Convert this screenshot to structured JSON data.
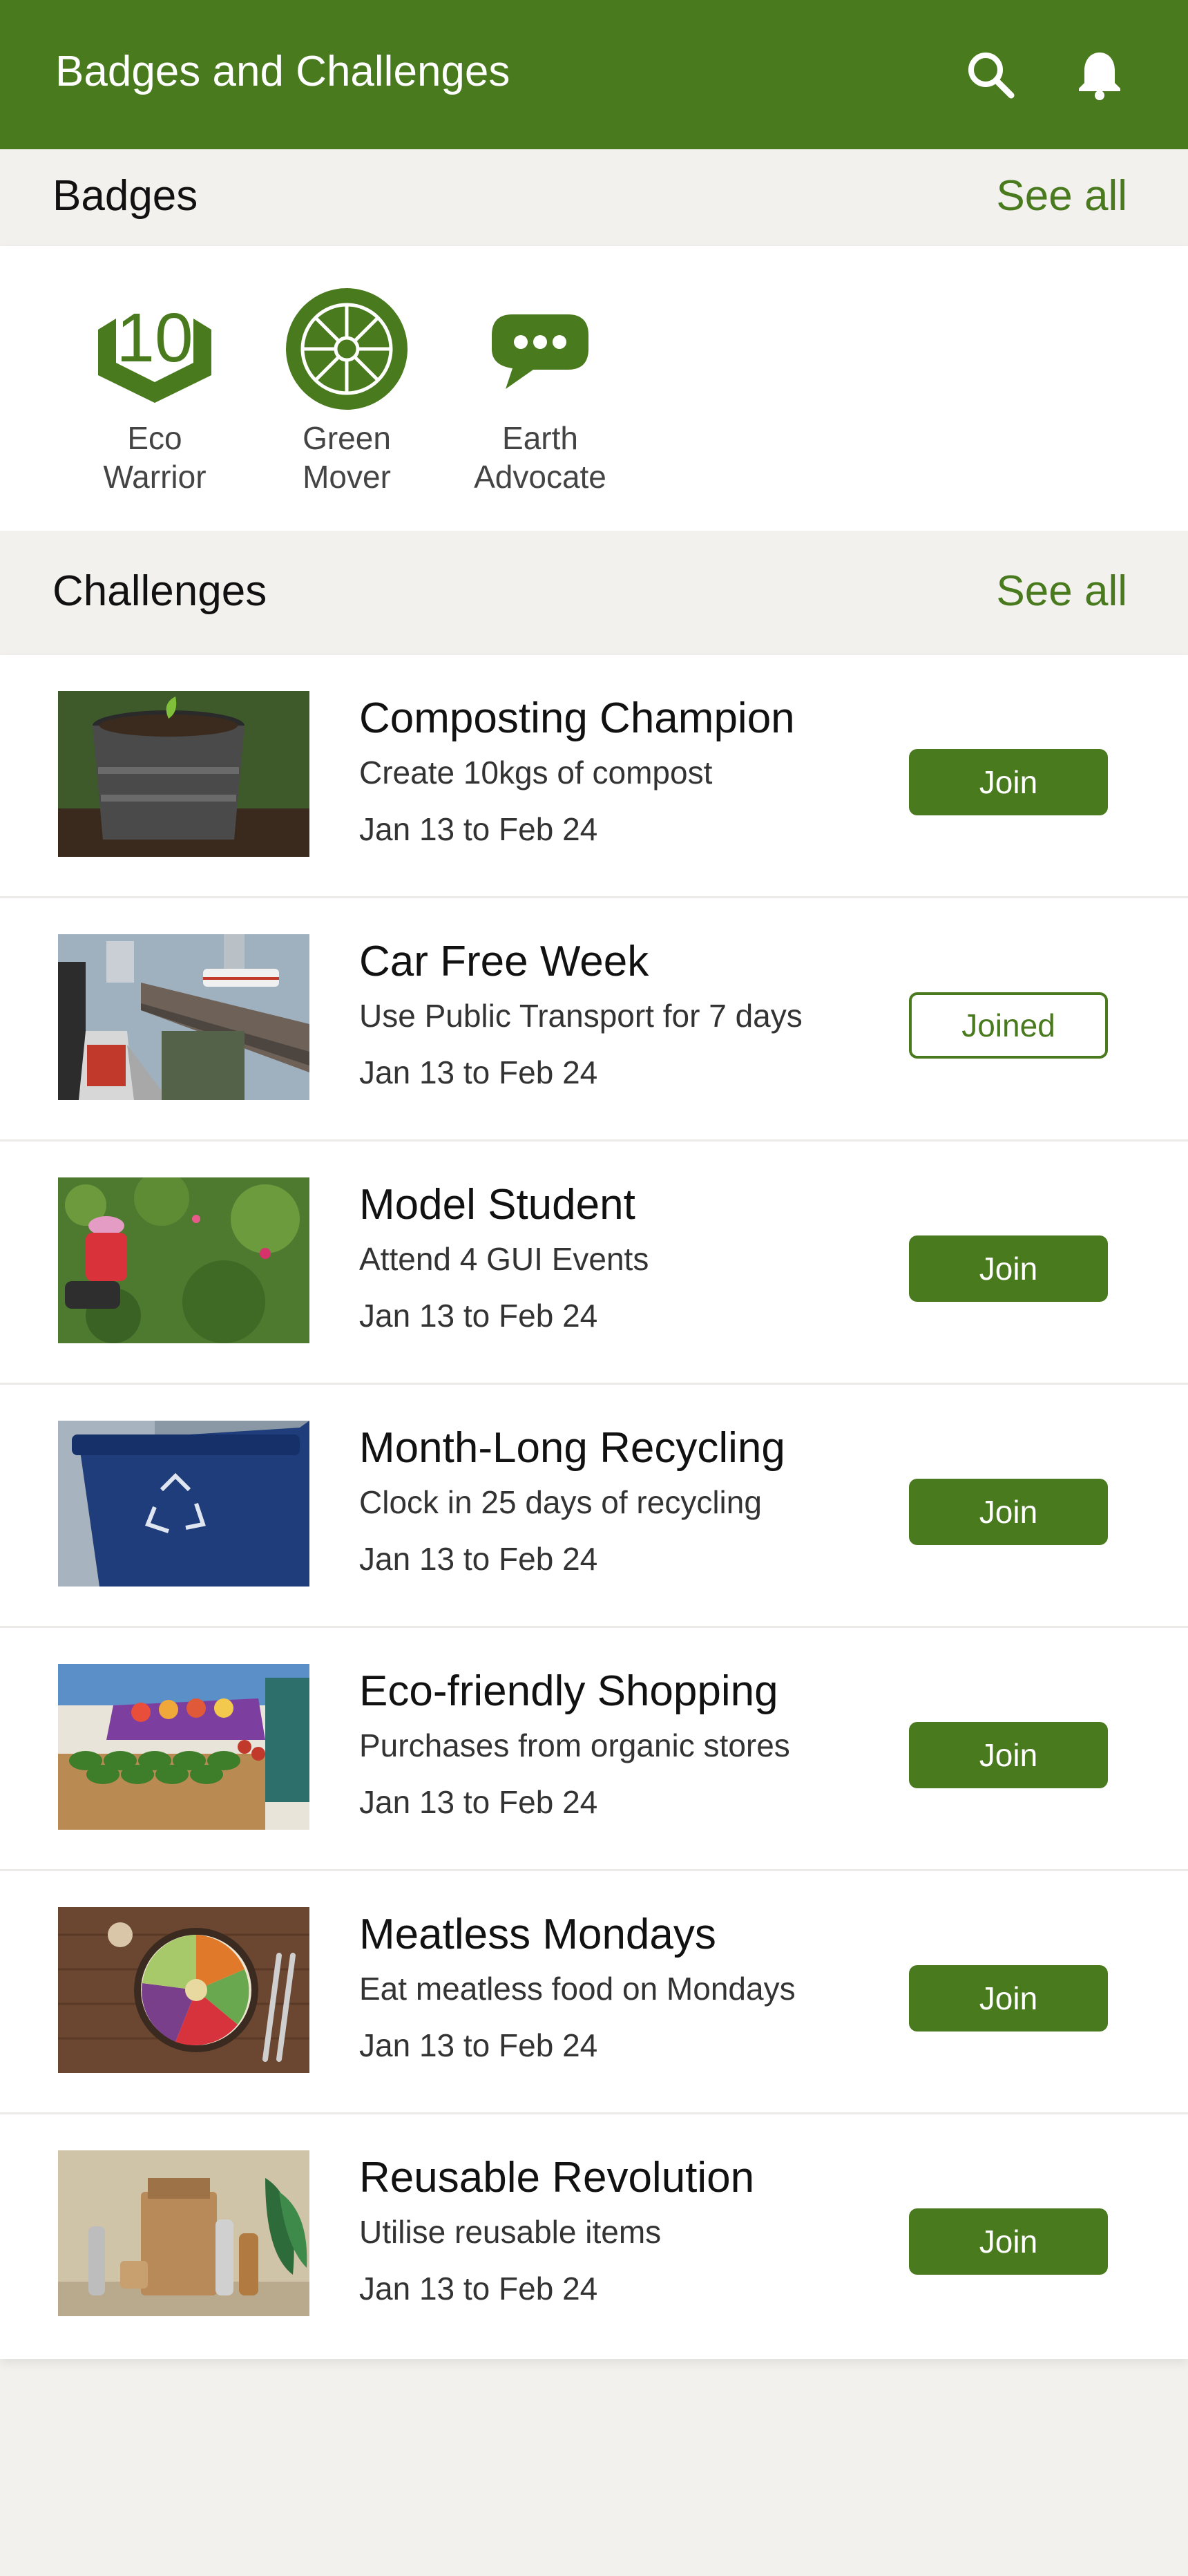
{
  "header": {
    "title": "Badges and Challenges",
    "search_icon": "search-icon",
    "bell_icon": "bell-icon",
    "color": "#4a7a1e"
  },
  "badges_section": {
    "title": "Badges",
    "see_all": "See all",
    "items": [
      {
        "name": "Eco\nWarrior",
        "icon": "eco-warrior-badge-icon",
        "number": "10"
      },
      {
        "name": "Green\nMover",
        "icon": "wheel-badge-icon"
      },
      {
        "name": "Earth\nAdvocate",
        "icon": "speech-bubble-badge-icon"
      }
    ]
  },
  "challenges_section": {
    "title": "Challenges",
    "see_all": "See all",
    "items": [
      {
        "title": "Composting Champion",
        "desc": "Create 10kgs of compost",
        "date": "Jan 13 to Feb 24",
        "button": "Join",
        "joined": false
      },
      {
        "title": "Car Free Week",
        "desc": "Use Public Transport for 7 days",
        "date": "Jan 13 to Feb 24",
        "button": "Joined",
        "joined": true
      },
      {
        "title": "Model Student",
        "desc": "Attend 4 GUI Events",
        "date": "Jan 13 to Feb 24",
        "button": "Join",
        "joined": false
      },
      {
        "title": "Month-Long Recycling",
        "desc": "Clock in 25 days of recycling",
        "date": "Jan 13 to Feb 24",
        "button": "Join",
        "joined": false
      },
      {
        "title": "Eco-friendly Shopping",
        "desc": "Purchases from organic stores",
        "date": "Jan 13 to Feb 24",
        "button": "Join",
        "joined": false
      },
      {
        "title": "Meatless Mondays",
        "desc": "Eat meatless food on Mondays",
        "date": "Jan 13 to Feb 24",
        "button": "Join",
        "joined": false
      },
      {
        "title": "Reusable Revolution",
        "desc": "Utilise reusable items",
        "date": "Jan 13 to Feb 24",
        "button": "Join",
        "joined": false
      }
    ]
  }
}
